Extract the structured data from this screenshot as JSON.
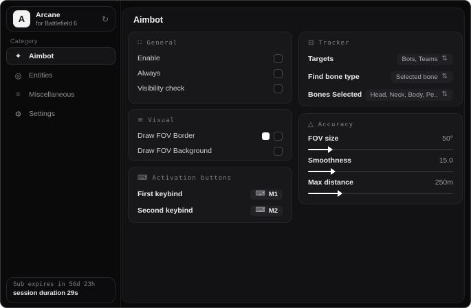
{
  "app": {
    "name": "Arcane",
    "subtitle": "for Battlefield 6",
    "avatar_letter": "A"
  },
  "icons": {
    "sync": "↻",
    "crosshair": "⌖",
    "entities": "◎",
    "miscellaneous": "⌗",
    "settings": "⚙",
    "general": "∷",
    "visual": "≡",
    "keyboard": "⌨",
    "tracker": "⊟",
    "accuracy": "△",
    "expand": "⇅"
  },
  "sidebar": {
    "category_label": "Category",
    "items": [
      {
        "label": "Aimbot",
        "active": true
      },
      {
        "label": "Entities",
        "active": false
      },
      {
        "label": "Miscellaneous",
        "active": false
      },
      {
        "label": "Settings",
        "active": false
      }
    ],
    "subscription": {
      "line1": "Sub expires in 56d 23h",
      "line2": "session duration 29s"
    }
  },
  "main": {
    "title": "Aimbot",
    "general": {
      "title": "General",
      "rows": [
        {
          "label": "Enable",
          "checked": false
        },
        {
          "label": "Always",
          "checked": false
        },
        {
          "label": "Visibility check",
          "checked": false
        }
      ]
    },
    "visual": {
      "title": "Visual",
      "rows": [
        {
          "label": "Draw FOV Border",
          "swatch": "#ffffff",
          "checked": false
        },
        {
          "label": "Draw FOV Background",
          "checked": false
        }
      ]
    },
    "activation": {
      "title": "Activation buttons",
      "rows": [
        {
          "label": "First keybind",
          "key": "M1"
        },
        {
          "label": "Second keybind",
          "key": "M2"
        }
      ]
    },
    "tracker": {
      "title": "Tracker",
      "rows": [
        {
          "label": "Targets",
          "value": "Bots, Teams"
        },
        {
          "label": "Find bone type",
          "value": "Selected bone"
        },
        {
          "label": "Bones Selected",
          "value": "Head, Neck, Body, Pe.."
        }
      ]
    },
    "accuracy": {
      "title": "Accuracy",
      "sliders": [
        {
          "label": "FOV size",
          "value": "50°",
          "percent": 14
        },
        {
          "label": "Smoothness",
          "value": "15.0",
          "percent": 16
        },
        {
          "label": "Max distance",
          "value": "250m",
          "percent": 21
        }
      ]
    }
  },
  "colors": {
    "window_bg": "#0a0a0b",
    "panel_bg": "#121214",
    "card_bg": "#18181b",
    "accent_fill": "#ffffff",
    "fov_border_swatch": "#ffffff"
  }
}
